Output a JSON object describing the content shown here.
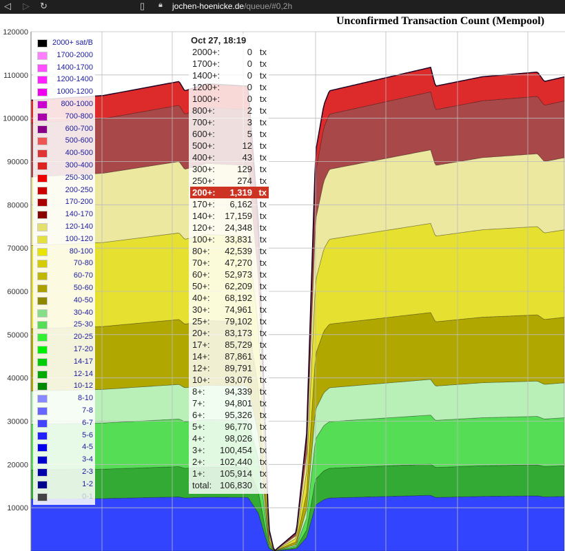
{
  "browser": {
    "back_icon": "arrow-left-icon",
    "forward_icon": "arrow-right-icon",
    "reload_icon": "reload-icon",
    "bookmark_icon": "bookmark-icon",
    "lock_icon": "lock-icon",
    "url_host": "jochen-hoenicke.de",
    "url_path": "/queue/#0,2h"
  },
  "chart_data": {
    "type": "area",
    "title": "Unconfirmed Transaction Count (Mempool)",
    "y_ticks": [
      "0",
      "10000",
      "20000",
      "30000",
      "40000",
      "50000",
      "60000",
      "70000",
      "80000",
      "90000",
      "100000",
      "110000",
      "120000"
    ],
    "ylim": [
      0,
      120000
    ],
    "grid": true,
    "legend_position": "top-left",
    "legend": [
      {
        "label": "2000+ sat/B",
        "color": "#000000"
      },
      {
        "label": "1700-2000",
        "color": "#ff80ff"
      },
      {
        "label": "1400-1700",
        "color": "#ff50ff"
      },
      {
        "label": "1200-1400",
        "color": "#ff20ff"
      },
      {
        "label": "1000-1200",
        "color": "#ee00ee"
      },
      {
        "label": "800-1000",
        "color": "#cc00cc"
      },
      {
        "label": "700-800",
        "color": "#aa00aa"
      },
      {
        "label": "600-700",
        "color": "#880088"
      },
      {
        "label": "500-600",
        "color": "#ee5555"
      },
      {
        "label": "400-500",
        "color": "#e03333"
      },
      {
        "label": "300-400",
        "color": "#dd2222"
      },
      {
        "label": "250-300",
        "color": "#ee0000"
      },
      {
        "label": "200-250",
        "color": "#cc0000"
      },
      {
        "label": "170-200",
        "color": "#aa0000"
      },
      {
        "label": "140-170",
        "color": "#880000"
      },
      {
        "label": "120-140",
        "color": "#e4e070"
      },
      {
        "label": "100-120",
        "color": "#e4e040"
      },
      {
        "label": "80-100",
        "color": "#e8e400"
      },
      {
        "label": "70-80",
        "color": "#d4cc00"
      },
      {
        "label": "60-70",
        "color": "#c0b800"
      },
      {
        "label": "50-60",
        "color": "#aaa000"
      },
      {
        "label": "40-50",
        "color": "#8e8800"
      },
      {
        "label": "30-40",
        "color": "#88dd88"
      },
      {
        "label": "25-30",
        "color": "#55dd55"
      },
      {
        "label": "20-25",
        "color": "#33ee33"
      },
      {
        "label": "17-20",
        "color": "#00ee00"
      },
      {
        "label": "14-17",
        "color": "#00cc00"
      },
      {
        "label": "12-14",
        "color": "#00aa00"
      },
      {
        "label": "10-12",
        "color": "#008800"
      },
      {
        "label": "8-10",
        "color": "#8888ff"
      },
      {
        "label": "7-8",
        "color": "#6666ff"
      },
      {
        "label": "6-7",
        "color": "#4444ff"
      },
      {
        "label": "5-6",
        "color": "#2222ff"
      },
      {
        "label": "4-5",
        "color": "#0000ee"
      },
      {
        "label": "3-4",
        "color": "#0000cc"
      },
      {
        "label": "2-3",
        "color": "#0000aa"
      },
      {
        "label": "1-2",
        "color": "#000088"
      },
      {
        "label": "0-1",
        "color": "#444444"
      }
    ],
    "tooltip": {
      "date": "Oct 27, 18:19",
      "unit": "tx",
      "highlight_label": "200+:",
      "rows": [
        {
          "label": "2000+:",
          "value": "0"
        },
        {
          "label": "1700+:",
          "value": "0"
        },
        {
          "label": "1400+:",
          "value": "0"
        },
        {
          "label": "1200+:",
          "value": "0"
        },
        {
          "label": "1000+:",
          "value": "0"
        },
        {
          "label": "800+:",
          "value": "2"
        },
        {
          "label": "700+:",
          "value": "3"
        },
        {
          "label": "600+:",
          "value": "5"
        },
        {
          "label": "500+:",
          "value": "12"
        },
        {
          "label": "400+:",
          "value": "43"
        },
        {
          "label": "300+:",
          "value": "129"
        },
        {
          "label": "250+:",
          "value": "274"
        },
        {
          "label": "200+:",
          "value": "1,319"
        },
        {
          "label": "170+:",
          "value": "6,162"
        },
        {
          "label": "140+:",
          "value": "17,159"
        },
        {
          "label": "120+:",
          "value": "24,348"
        },
        {
          "label": "100+:",
          "value": "33,831"
        },
        {
          "label": "80+:",
          "value": "42,539"
        },
        {
          "label": "70+:",
          "value": "47,270"
        },
        {
          "label": "60+:",
          "value": "52,973"
        },
        {
          "label": "50+:",
          "value": "62,209"
        },
        {
          "label": "40+:",
          "value": "68,192"
        },
        {
          "label": "30+:",
          "value": "74,961"
        },
        {
          "label": "25+:",
          "value": "79,102"
        },
        {
          "label": "20+:",
          "value": "83,173"
        },
        {
          "label": "17+:",
          "value": "85,729"
        },
        {
          "label": "14+:",
          "value": "87,861"
        },
        {
          "label": "12+:",
          "value": "89,791"
        },
        {
          "label": "10+:",
          "value": "93,076"
        },
        {
          "label": "8+:",
          "value": "94,339"
        },
        {
          "label": "7+:",
          "value": "94,801"
        },
        {
          "label": "6+:",
          "value": "95,326"
        },
        {
          "label": "5+:",
          "value": "96,770"
        },
        {
          "label": "4+:",
          "value": "98,026"
        },
        {
          "label": "3+:",
          "value": "100,454"
        },
        {
          "label": "2+:",
          "value": "102,440"
        },
        {
          "label": "1+:",
          "value": "105,914"
        },
        {
          "label": "total:",
          "value": "106,830"
        }
      ]
    },
    "stack_bands": [
      {
        "range": "0-8",
        "color": "#3344ff",
        "value": 12500
      },
      {
        "range": "8-12",
        "color": "#33aa33",
        "value": 7000
      },
      {
        "range": "12-20",
        "color": "#55dd55",
        "value": 11000
      },
      {
        "range": "20-40",
        "color": "#b8f0b8",
        "value": 8000
      },
      {
        "range": "40-70",
        "color": "#b0a800",
        "value": 15000
      },
      {
        "range": "70-120",
        "color": "#e6e030",
        "value": 20000
      },
      {
        "range": "120-170",
        "color": "#ece8a0",
        "value": 16500
      },
      {
        "range": "170-250",
        "color": "#a84848",
        "value": 13000
      },
      {
        "range": "250+",
        "color": "#dd2b2b",
        "value": 5500
      }
    ]
  }
}
